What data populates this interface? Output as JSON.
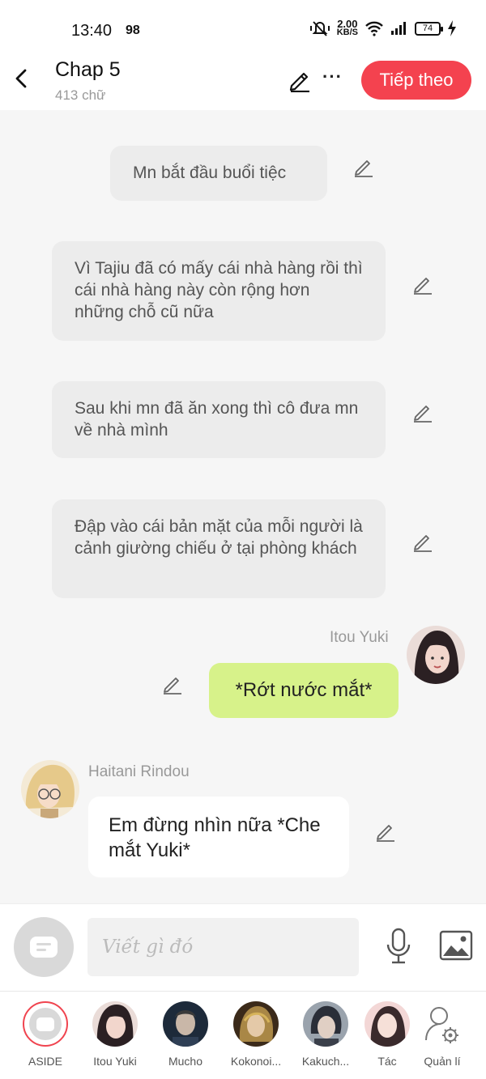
{
  "status_bar": {
    "time": "13:40",
    "notif_count": "98",
    "speed_value": "2.00",
    "speed_unit": "KB/S",
    "battery": "74"
  },
  "header": {
    "title": "Chap 5",
    "subtitle": "413 chữ",
    "next_label": "Tiếp theo",
    "more_label": "···",
    "accent_color": "#f4424f"
  },
  "messages": {
    "narration": [
      {
        "text": "Mn bắt đầu buổi tiệc"
      },
      {
        "text": "Vì Tajiu đã có mấy cái nhà hàng rồi thì cái nhà hàng này còn rộng hơn những chỗ cũ nữa"
      },
      {
        "text": "Sau khi mn đã ăn xong thì cô đưa mn về nhà mình"
      },
      {
        "text": "Đập vào cái bản mặt của mỗi người là cảnh giường chiếu ở tại phòng khách"
      }
    ],
    "right_message": {
      "sender": "Itou Yuki",
      "text": "*Rớt nước mắt*",
      "bubble_color": "#d7f28a"
    },
    "left_message": {
      "sender": "Haitani Rindou",
      "text": "Em đừng nhìn nữa *Che mắt Yuki*"
    }
  },
  "composer": {
    "placeholder": "Viết gì đó",
    "mic_icon": "microphone-icon",
    "image_icon": "image-icon"
  },
  "characters": [
    {
      "label": "ASIDE"
    },
    {
      "label": "Itou Yuki"
    },
    {
      "label": "Mucho"
    },
    {
      "label": "Kokonoi..."
    },
    {
      "label": "Kakuch..."
    },
    {
      "label": "Tác"
    },
    {
      "label": "Quản lí"
    }
  ]
}
